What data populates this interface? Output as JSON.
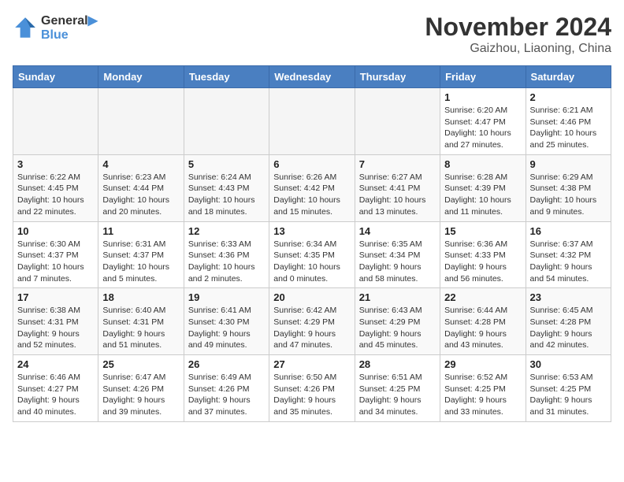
{
  "header": {
    "logo_line1": "General",
    "logo_line2": "Blue",
    "month": "November 2024",
    "location": "Gaizhou, Liaoning, China"
  },
  "weekdays": [
    "Sunday",
    "Monday",
    "Tuesday",
    "Wednesday",
    "Thursday",
    "Friday",
    "Saturday"
  ],
  "weeks": [
    [
      {
        "day": "",
        "empty": true
      },
      {
        "day": "",
        "empty": true
      },
      {
        "day": "",
        "empty": true
      },
      {
        "day": "",
        "empty": true
      },
      {
        "day": "",
        "empty": true
      },
      {
        "day": "1",
        "sunrise": "6:20 AM",
        "sunset": "4:47 PM",
        "daylight": "10 hours and 27 minutes."
      },
      {
        "day": "2",
        "sunrise": "6:21 AM",
        "sunset": "4:46 PM",
        "daylight": "10 hours and 25 minutes."
      }
    ],
    [
      {
        "day": "3",
        "sunrise": "6:22 AM",
        "sunset": "4:45 PM",
        "daylight": "10 hours and 22 minutes."
      },
      {
        "day": "4",
        "sunrise": "6:23 AM",
        "sunset": "4:44 PM",
        "daylight": "10 hours and 20 minutes."
      },
      {
        "day": "5",
        "sunrise": "6:24 AM",
        "sunset": "4:43 PM",
        "daylight": "10 hours and 18 minutes."
      },
      {
        "day": "6",
        "sunrise": "6:26 AM",
        "sunset": "4:42 PM",
        "daylight": "10 hours and 15 minutes."
      },
      {
        "day": "7",
        "sunrise": "6:27 AM",
        "sunset": "4:41 PM",
        "daylight": "10 hours and 13 minutes."
      },
      {
        "day": "8",
        "sunrise": "6:28 AM",
        "sunset": "4:39 PM",
        "daylight": "10 hours and 11 minutes."
      },
      {
        "day": "9",
        "sunrise": "6:29 AM",
        "sunset": "4:38 PM",
        "daylight": "10 hours and 9 minutes."
      }
    ],
    [
      {
        "day": "10",
        "sunrise": "6:30 AM",
        "sunset": "4:37 PM",
        "daylight": "10 hours and 7 minutes."
      },
      {
        "day": "11",
        "sunrise": "6:31 AM",
        "sunset": "4:37 PM",
        "daylight": "10 hours and 5 minutes."
      },
      {
        "day": "12",
        "sunrise": "6:33 AM",
        "sunset": "4:36 PM",
        "daylight": "10 hours and 2 minutes."
      },
      {
        "day": "13",
        "sunrise": "6:34 AM",
        "sunset": "4:35 PM",
        "daylight": "10 hours and 0 minutes."
      },
      {
        "day": "14",
        "sunrise": "6:35 AM",
        "sunset": "4:34 PM",
        "daylight": "9 hours and 58 minutes."
      },
      {
        "day": "15",
        "sunrise": "6:36 AM",
        "sunset": "4:33 PM",
        "daylight": "9 hours and 56 minutes."
      },
      {
        "day": "16",
        "sunrise": "6:37 AM",
        "sunset": "4:32 PM",
        "daylight": "9 hours and 54 minutes."
      }
    ],
    [
      {
        "day": "17",
        "sunrise": "6:38 AM",
        "sunset": "4:31 PM",
        "daylight": "9 hours and 52 minutes."
      },
      {
        "day": "18",
        "sunrise": "6:40 AM",
        "sunset": "4:31 PM",
        "daylight": "9 hours and 51 minutes."
      },
      {
        "day": "19",
        "sunrise": "6:41 AM",
        "sunset": "4:30 PM",
        "daylight": "9 hours and 49 minutes."
      },
      {
        "day": "20",
        "sunrise": "6:42 AM",
        "sunset": "4:29 PM",
        "daylight": "9 hours and 47 minutes."
      },
      {
        "day": "21",
        "sunrise": "6:43 AM",
        "sunset": "4:29 PM",
        "daylight": "9 hours and 45 minutes."
      },
      {
        "day": "22",
        "sunrise": "6:44 AM",
        "sunset": "4:28 PM",
        "daylight": "9 hours and 43 minutes."
      },
      {
        "day": "23",
        "sunrise": "6:45 AM",
        "sunset": "4:28 PM",
        "daylight": "9 hours and 42 minutes."
      }
    ],
    [
      {
        "day": "24",
        "sunrise": "6:46 AM",
        "sunset": "4:27 PM",
        "daylight": "9 hours and 40 minutes."
      },
      {
        "day": "25",
        "sunrise": "6:47 AM",
        "sunset": "4:26 PM",
        "daylight": "9 hours and 39 minutes."
      },
      {
        "day": "26",
        "sunrise": "6:49 AM",
        "sunset": "4:26 PM",
        "daylight": "9 hours and 37 minutes."
      },
      {
        "day": "27",
        "sunrise": "6:50 AM",
        "sunset": "4:26 PM",
        "daylight": "9 hours and 35 minutes."
      },
      {
        "day": "28",
        "sunrise": "6:51 AM",
        "sunset": "4:25 PM",
        "daylight": "9 hours and 34 minutes."
      },
      {
        "day": "29",
        "sunrise": "6:52 AM",
        "sunset": "4:25 PM",
        "daylight": "9 hours and 33 minutes."
      },
      {
        "day": "30",
        "sunrise": "6:53 AM",
        "sunset": "4:25 PM",
        "daylight": "9 hours and 31 minutes."
      }
    ]
  ]
}
